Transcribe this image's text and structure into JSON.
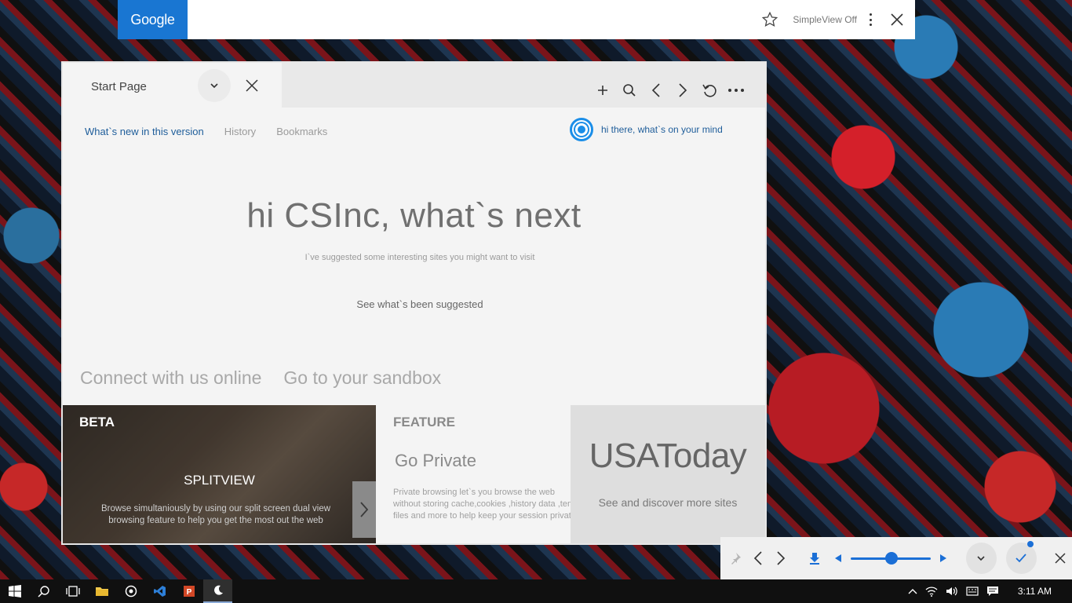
{
  "google_bar": {
    "logo": "Google",
    "simpleview_label": "SimpleView Off"
  },
  "browser": {
    "tab_title": "Start Page",
    "subnav": {
      "whats_new": "What`s new in this version",
      "history": "History",
      "bookmarks": "Bookmarks"
    },
    "cortana_text": "hi there, what`s on your mind",
    "headline": "hi CSInc, what`s next",
    "subline": "I`ve suggested some interesting sites you might want to visit",
    "see_suggested": "See what`s been suggested",
    "links": {
      "connect": "Connect with us online",
      "sandbox": "Go to your sandbox"
    },
    "cards": {
      "beta": {
        "label": "BETA",
        "title": "SPLITVIEW",
        "description": "Browse simultaniously by using our split screen dual view browsing feature to help  you get the most out the web"
      },
      "feature": {
        "label": "FEATURE",
        "title": "Go Private",
        "description": "Private browsing let`s you browse the web without storing cache,cookies ,history data ,temp files and more to help keep your session private"
      },
      "usatoday": {
        "title": "USAToday",
        "description": "See and discover more sites"
      }
    }
  },
  "control_bar": {
    "slider_value": 0.5
  },
  "taskbar": {
    "time": "3:11 AM"
  },
  "colors": {
    "google_blue": "#1976d2",
    "accent_blue": "#1e5d9a",
    "cortana_blue": "#1b8ee8"
  }
}
